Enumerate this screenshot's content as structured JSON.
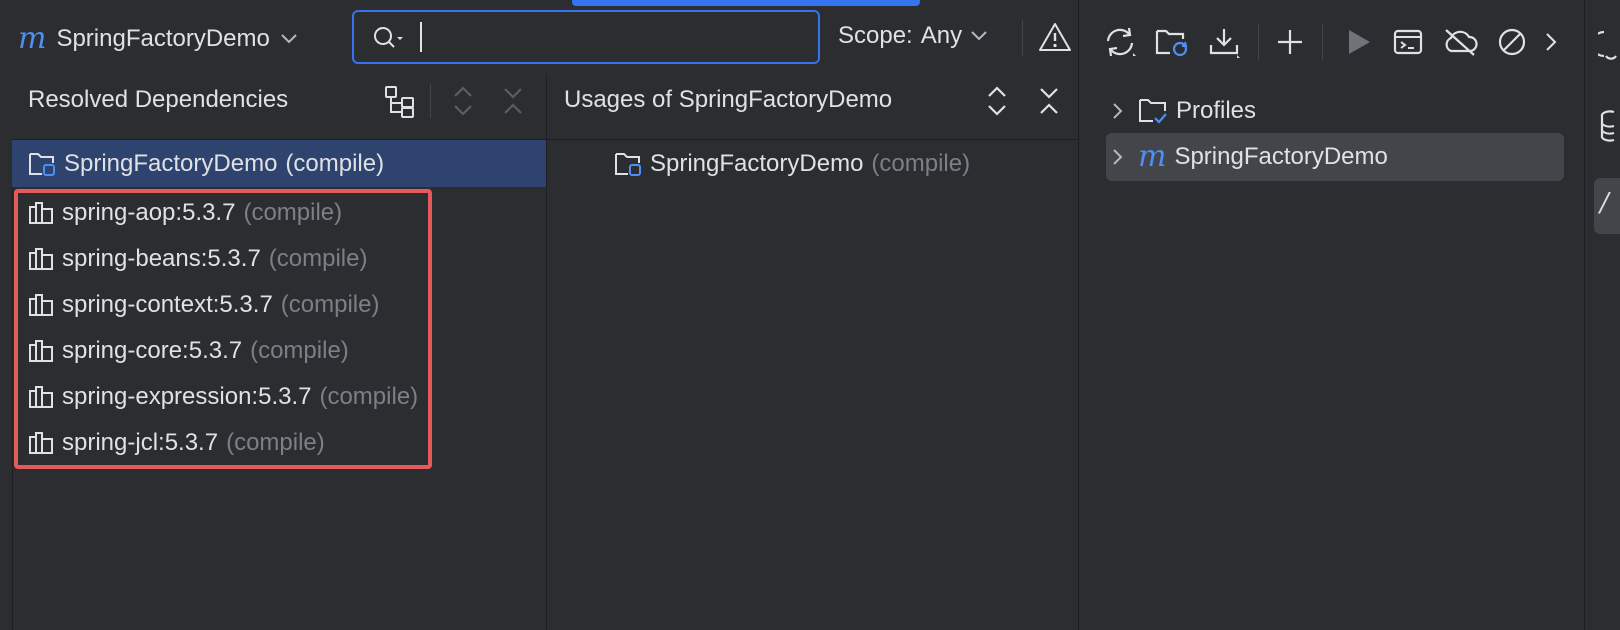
{
  "project_selector": {
    "icon": "maven-m",
    "label": "SpringFactoryDemo"
  },
  "search": {
    "value": "",
    "placeholder": ""
  },
  "scope": {
    "label": "Scope:",
    "value": "Any"
  },
  "resolved_panel": {
    "title": "Resolved Dependencies",
    "root": {
      "name": "SpringFactoryDemo",
      "scope": "(compile)"
    },
    "dependencies": [
      {
        "name": "spring-aop:5.3.7",
        "scope": "(compile)"
      },
      {
        "name": "spring-beans:5.3.7",
        "scope": "(compile)"
      },
      {
        "name": "spring-context:5.3.7",
        "scope": "(compile)"
      },
      {
        "name": "spring-core:5.3.7",
        "scope": "(compile)"
      },
      {
        "name": "spring-expression:5.3.7",
        "scope": "(compile)"
      },
      {
        "name": "spring-jcl:5.3.7",
        "scope": "(compile)"
      }
    ]
  },
  "usages_panel": {
    "title": "Usages of SpringFactoryDemo",
    "item": {
      "name": "SpringFactoryDemo",
      "scope": "(compile)"
    }
  },
  "maven_panel": {
    "tree": [
      {
        "label": "Profiles",
        "icon": "folder-check-icon"
      },
      {
        "label": "SpringFactoryDemo",
        "icon": "maven-m"
      }
    ]
  },
  "colors": {
    "background": "#2b2d30",
    "accent": "#3574f0",
    "selection": "#2e436e",
    "highlight_border": "#e55b5b",
    "maven_icon": "#4d8ff5"
  }
}
